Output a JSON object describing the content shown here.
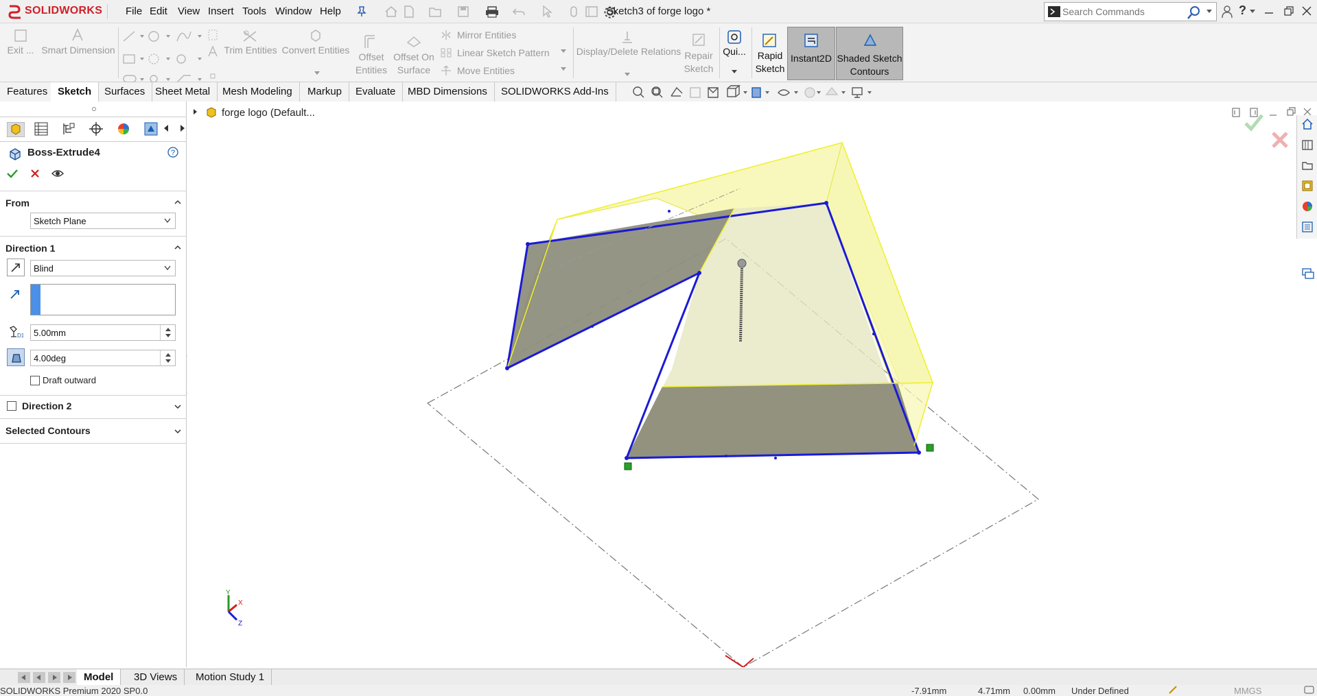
{
  "app": {
    "logo_text": "SOLIDWORKS",
    "window_title": "Sketch3 of forge logo *",
    "search_placeholder": "Search Commands"
  },
  "menu": [
    "File",
    "Edit",
    "View",
    "Insert",
    "Tools",
    "Window",
    "Help"
  ],
  "commands": {
    "exit": "Exit ...",
    "smart_dimension": "Smart Dimension",
    "trim_entities": "Trim Entities",
    "convert_entities": "Convert Entities",
    "offset_entities": [
      "Offset",
      "Entities"
    ],
    "offset_on_surface": [
      "Offset On",
      "Surface"
    ],
    "mirror_entities": "Mirror Entities",
    "linear_sketch_pattern": "Linear Sketch Pattern",
    "move_entities": "Move Entities",
    "display_delete_relations": "Display/Delete Relations",
    "repair_sketch": [
      "Repair",
      "Sketch"
    ],
    "quick_snaps": "Qui...",
    "rapid_sketch": [
      "Rapid",
      "Sketch"
    ],
    "instant2d": "Instant2D",
    "shaded_sketch_contours": [
      "Shaded Sketch",
      "Contours"
    ]
  },
  "tabs": [
    "Features",
    "Sketch",
    "Surfaces",
    "Sheet Metal",
    "Mesh Modeling",
    "Markup",
    "Evaluate",
    "MBD Dimensions",
    "SOLIDWORKS Add-Ins"
  ],
  "active_tab": "Sketch",
  "tree": {
    "root_label": "forge logo  (Default..."
  },
  "property_manager": {
    "title": "Boss-Extrude4",
    "from_label": "From",
    "from_value": "Sketch Plane",
    "direction1_label": "Direction 1",
    "end_condition": "Blind",
    "depth": "5.00mm",
    "draft_angle": "4.00deg",
    "draft_outward_label": "Draft outward",
    "draft_outward_checked": false,
    "direction2_label": "Direction 2",
    "direction2_checked": false,
    "selected_contours_label": "Selected Contours"
  },
  "triad": {
    "x": "X",
    "y": "Y",
    "z": "Z"
  },
  "bottom_tabs": [
    "Model",
    "3D Views",
    "Motion Study 1"
  ],
  "active_bottom_tab": "Model",
  "status": {
    "product": "SOLIDWORKS Premium 2020 SP0.0",
    "coords": "-7.91mm",
    "coords2": "4.71mm",
    "coords3": "0.00mm",
    "sketch_state": "Under Defined",
    "units": "MMGS"
  },
  "colors": {
    "accent_red": "#d0202a",
    "sketch_blue": "#1a1ad6",
    "preview_yellow": "#f5f58a",
    "shaded_face": "#8f8f7e"
  }
}
